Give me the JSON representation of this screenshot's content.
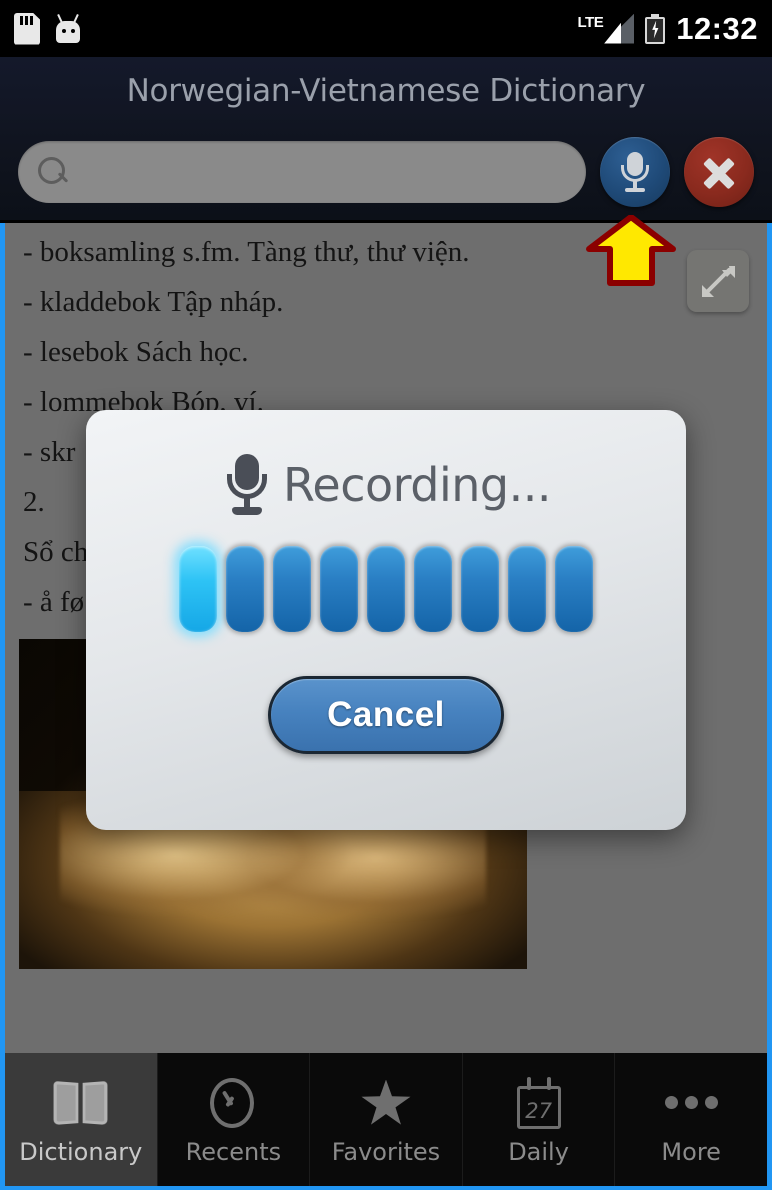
{
  "status_bar": {
    "time": "12:32",
    "network": "LTE",
    "icons": [
      "sd-card-icon",
      "android-robot-icon",
      "lte-signal-icon",
      "battery-charging-icon"
    ]
  },
  "header": {
    "title": "Norwegian-Vietnamese Dictionary",
    "search": {
      "value": "",
      "placeholder": ""
    },
    "mic_button_label": "microphone-icon",
    "clear_button_label": "clear-icon"
  },
  "content": {
    "entries": [
      "- boksamling s.fm. Tàng thư, thư viện.",
      "- kladdebok Tập nháp.",
      "- lesebok Sách học.",
      "- lommebok Bóp, ví.",
      "- skr",
      "2.",
      "Sổ ch",
      "- å fø"
    ],
    "expand_button": "expand-fullscreen-icon",
    "image_alt": "open-old-book-photo"
  },
  "arrow_hint": {
    "name": "yellow-up-arrow-annotation",
    "fill": "#FFE800",
    "stroke": "#8B0000"
  },
  "dialog": {
    "title": "Recording...",
    "mic_icon": "microphone-icon",
    "level_bars": {
      "count": 9,
      "lit_index": 0,
      "lit_color": "#2EC3F5",
      "color": "#2A7FC4"
    },
    "cancel_label": "Cancel"
  },
  "bottom_nav": {
    "active_index": 0,
    "items": [
      {
        "label": "Dictionary",
        "icon": "book-icon"
      },
      {
        "label": "Recents",
        "icon": "clock-check-icon"
      },
      {
        "label": "Favorites",
        "icon": "star-icon"
      },
      {
        "label": "Daily",
        "icon": "calendar-icon",
        "day": "27"
      },
      {
        "label": "More",
        "icon": "ellipsis-icon"
      }
    ]
  },
  "colors": {
    "accent_blue": "#2196F3",
    "header_bg": "#10141F",
    "content_bg": "#6E6E6E",
    "nav_bg": "#0A0A0A",
    "dialog_bg": "#E4E7EA"
  }
}
